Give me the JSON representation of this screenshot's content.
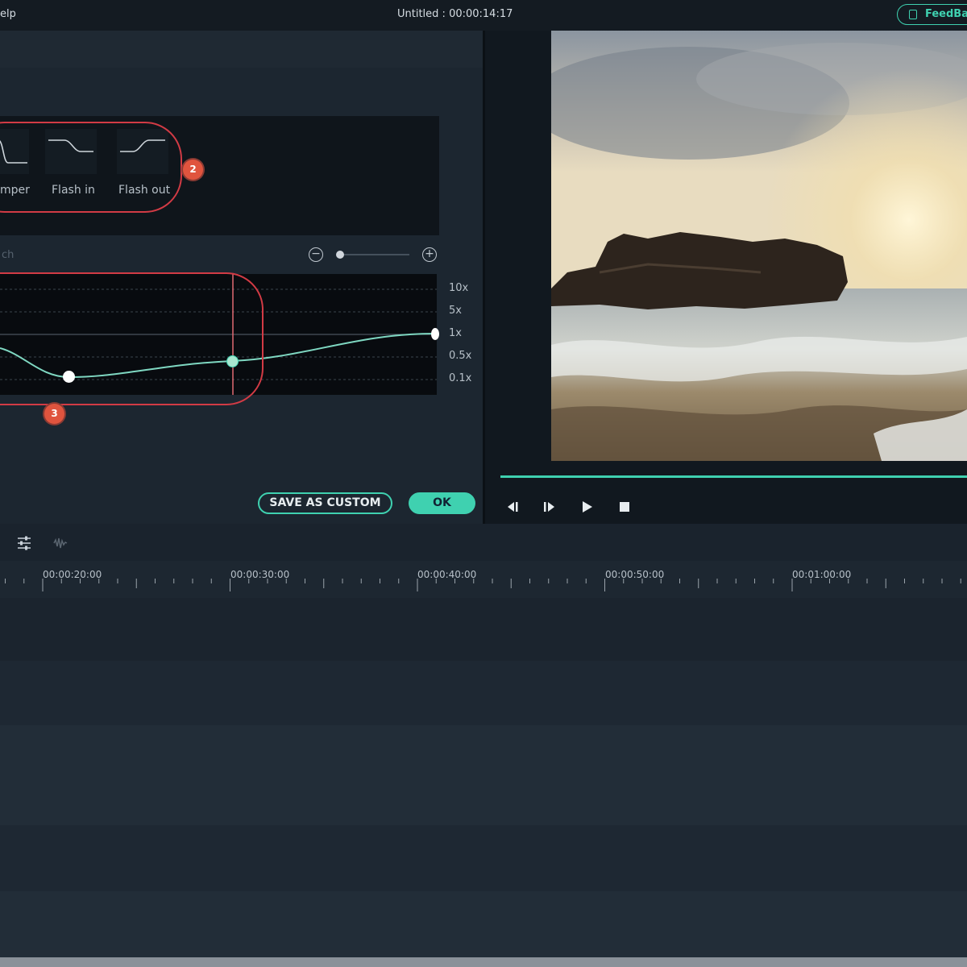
{
  "titlebar": {
    "menu_help": "elp",
    "title": "Untitled : 00:00:14:17",
    "feedback_label": "FeedBa"
  },
  "presets": [
    {
      "label": "mper"
    },
    {
      "label": "Flash in"
    },
    {
      "label": "Flash out"
    }
  ],
  "badges": {
    "presets": "2",
    "graph": "3"
  },
  "graph": {
    "label": "ch",
    "zoom_out_icon": "minus-circle-icon",
    "zoom_in_icon": "plus-circle-icon",
    "y_labels": [
      "10x",
      "5x",
      "1x",
      "0.5x",
      "0.1x"
    ]
  },
  "buttons": {
    "save_custom": "SAVE AS CUSTOM",
    "ok": "OK"
  },
  "playback": {
    "icons": [
      "step-back-icon",
      "step-forward-icon",
      "play-icon",
      "stop-icon"
    ],
    "progress": 1.0
  },
  "timeline": {
    "ruler_labels": [
      "00:00:20:00",
      "00:00:30:00",
      "00:00:40:00",
      "00:00:50:00",
      "00:01:00:00"
    ],
    "toolbar_icons": [
      "adjust-icon",
      "audio-icon"
    ]
  },
  "colors": {
    "accent": "#3fd1b0",
    "highlight": "#d23b45",
    "badge": "#e0543e"
  }
}
